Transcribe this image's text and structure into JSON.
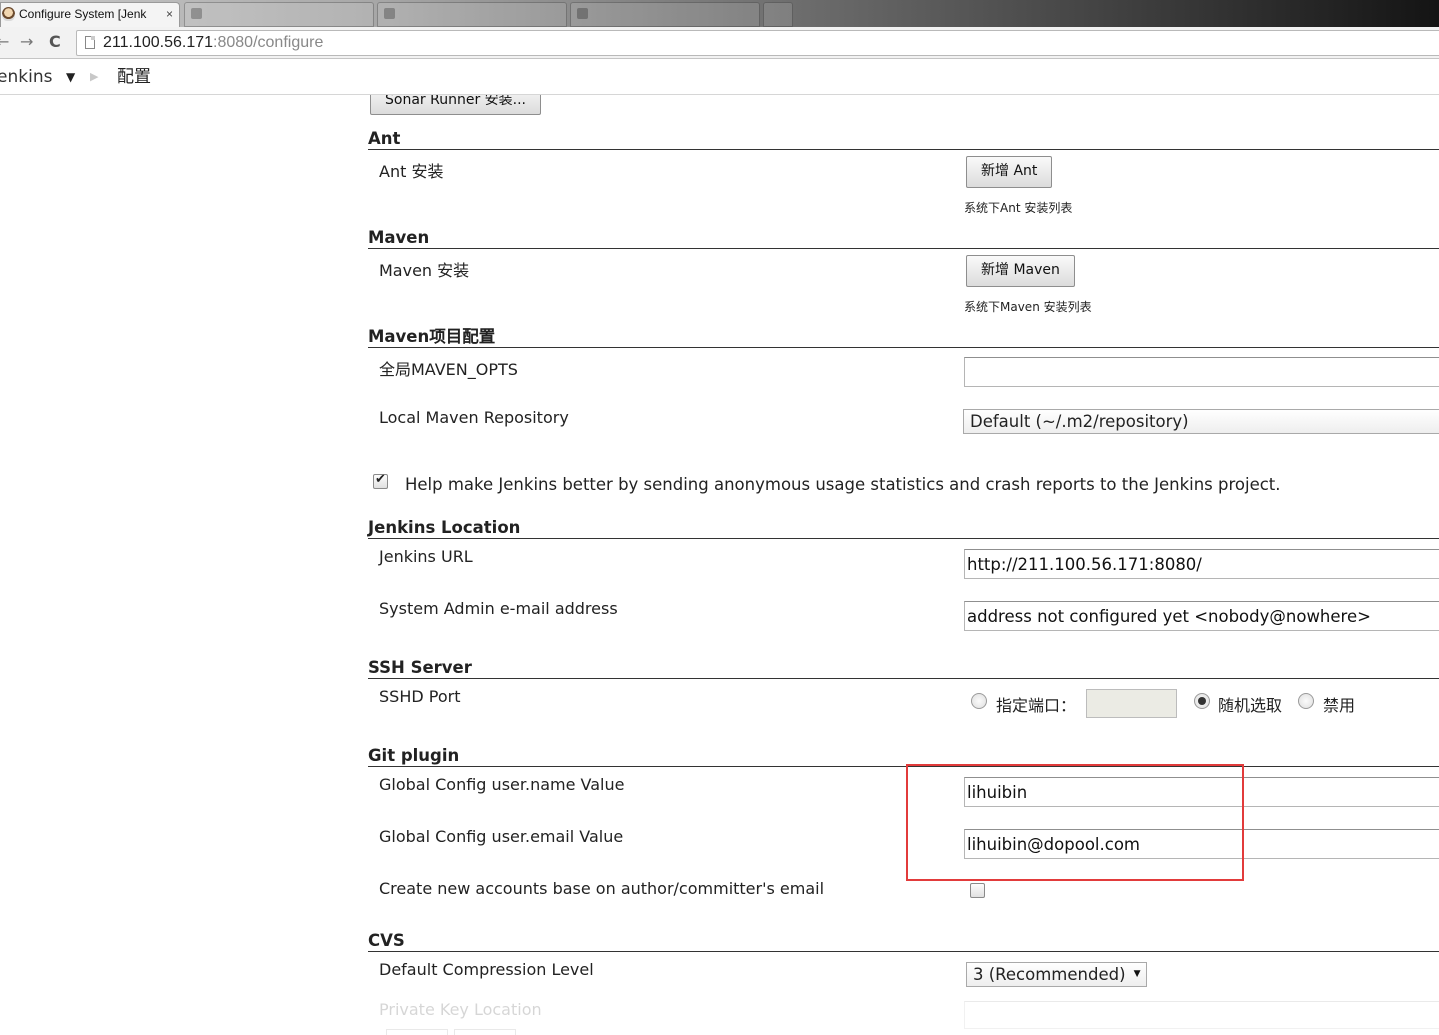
{
  "browser": {
    "active_tab_title": "Configure System [Jenk",
    "tab_close": "×",
    "bg_tabs": [
      "",
      "",
      "",
      ""
    ],
    "url_host": "211.100.56.171",
    "url_rest": ":8080/configure",
    "nav_back": "←",
    "nav_forward": "→",
    "nav_reload": "C"
  },
  "breadcrumbs": {
    "root": "Jenkins",
    "caret": "▼",
    "separator": "▶",
    "page": "配置"
  },
  "sonar": {
    "button": "Sonar Runner 安装..."
  },
  "ant": {
    "heading": "Ant",
    "label": "Ant 安装",
    "button": "新增 Ant",
    "hint": "系统下Ant 安装列表"
  },
  "maven": {
    "heading": "Maven",
    "label": "Maven 安装",
    "button": "新增 Maven",
    "hint": "系统下Maven 安装列表"
  },
  "maven_project": {
    "heading": "Maven项目配置",
    "opts_label": "全局MAVEN_OPTS",
    "opts_value": "",
    "repo_label": "Local Maven Repository",
    "repo_value": "Default (~/.m2/repository)"
  },
  "usage_stats": {
    "checked": true,
    "label": "Help make Jenkins better by sending anonymous usage statistics and crash reports to the Jenkins project."
  },
  "jenkins_location": {
    "heading": "Jenkins Location",
    "url_label": "Jenkins URL",
    "url_value": "http://211.100.56.171:8080/",
    "email_label": "System Admin e-mail address",
    "email_value": "address not configured yet <nobody@nowhere>"
  },
  "ssh_server": {
    "heading": "SSH Server",
    "port_label": "SSHD Port",
    "fixed_label": "指定端口：",
    "random_label": "随机选取",
    "disable_label": "禁用",
    "selected": "随机选取"
  },
  "git_plugin": {
    "heading": "Git plugin",
    "name_label": "Global Config user.name Value",
    "name_value": "lihuibin",
    "email_label": "Global Config user.email Value",
    "email_value": "lihuibin@dopool.com",
    "create_accounts_label": "Create new accounts base on author/committer's email",
    "create_accounts_checked": false
  },
  "cvs": {
    "heading": "CVS",
    "compression_label": "Default Compression Level",
    "compression_value": "3 (Recommended)",
    "private_key_label": "Private Key Location"
  },
  "colors": {
    "highlight": "#e23b3b",
    "section_rule": "#333333"
  }
}
